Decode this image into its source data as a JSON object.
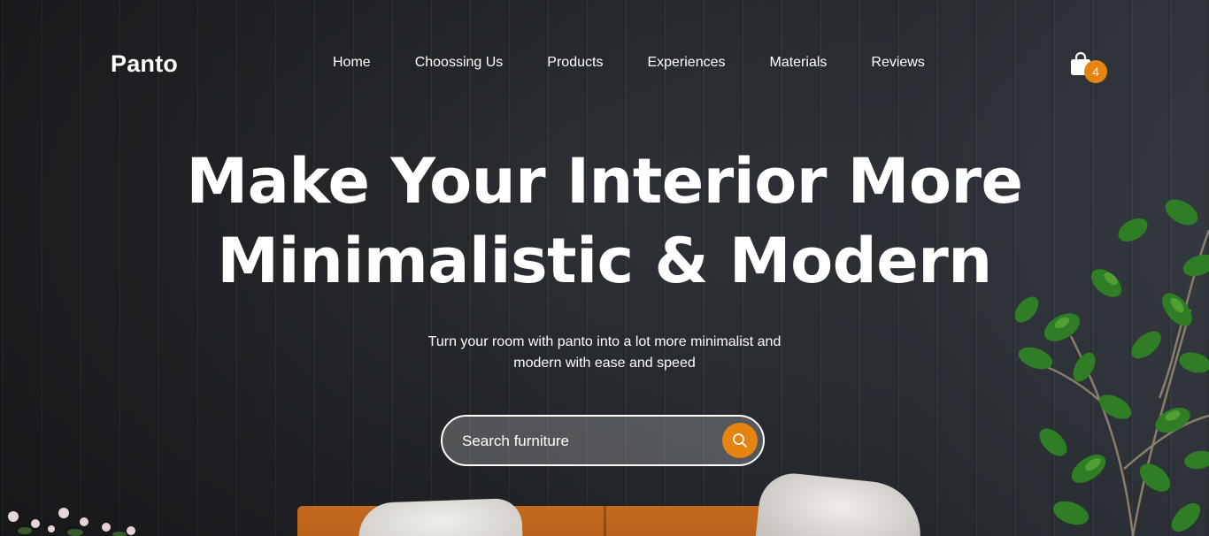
{
  "brand": {
    "logo": "Panto"
  },
  "nav": {
    "items": [
      {
        "label": "Home"
      },
      {
        "label": "Choossing Us"
      },
      {
        "label": "Products"
      },
      {
        "label": "Experiences"
      },
      {
        "label": "Materials"
      },
      {
        "label": "Reviews"
      }
    ]
  },
  "cart": {
    "icon": "shopping-bag-icon",
    "count": "4"
  },
  "hero": {
    "headline_line1": "Make Your Interior More",
    "headline_line2": "Minimalistic & Modern",
    "subtitle": "Turn your room with panto into a lot more minimalist and modern with ease and speed"
  },
  "search": {
    "placeholder": "Search furniture",
    "value": "",
    "button_icon": "search-icon"
  },
  "colors": {
    "accent": "#E58411",
    "background": "#212429",
    "text": "#FFFFFF"
  }
}
